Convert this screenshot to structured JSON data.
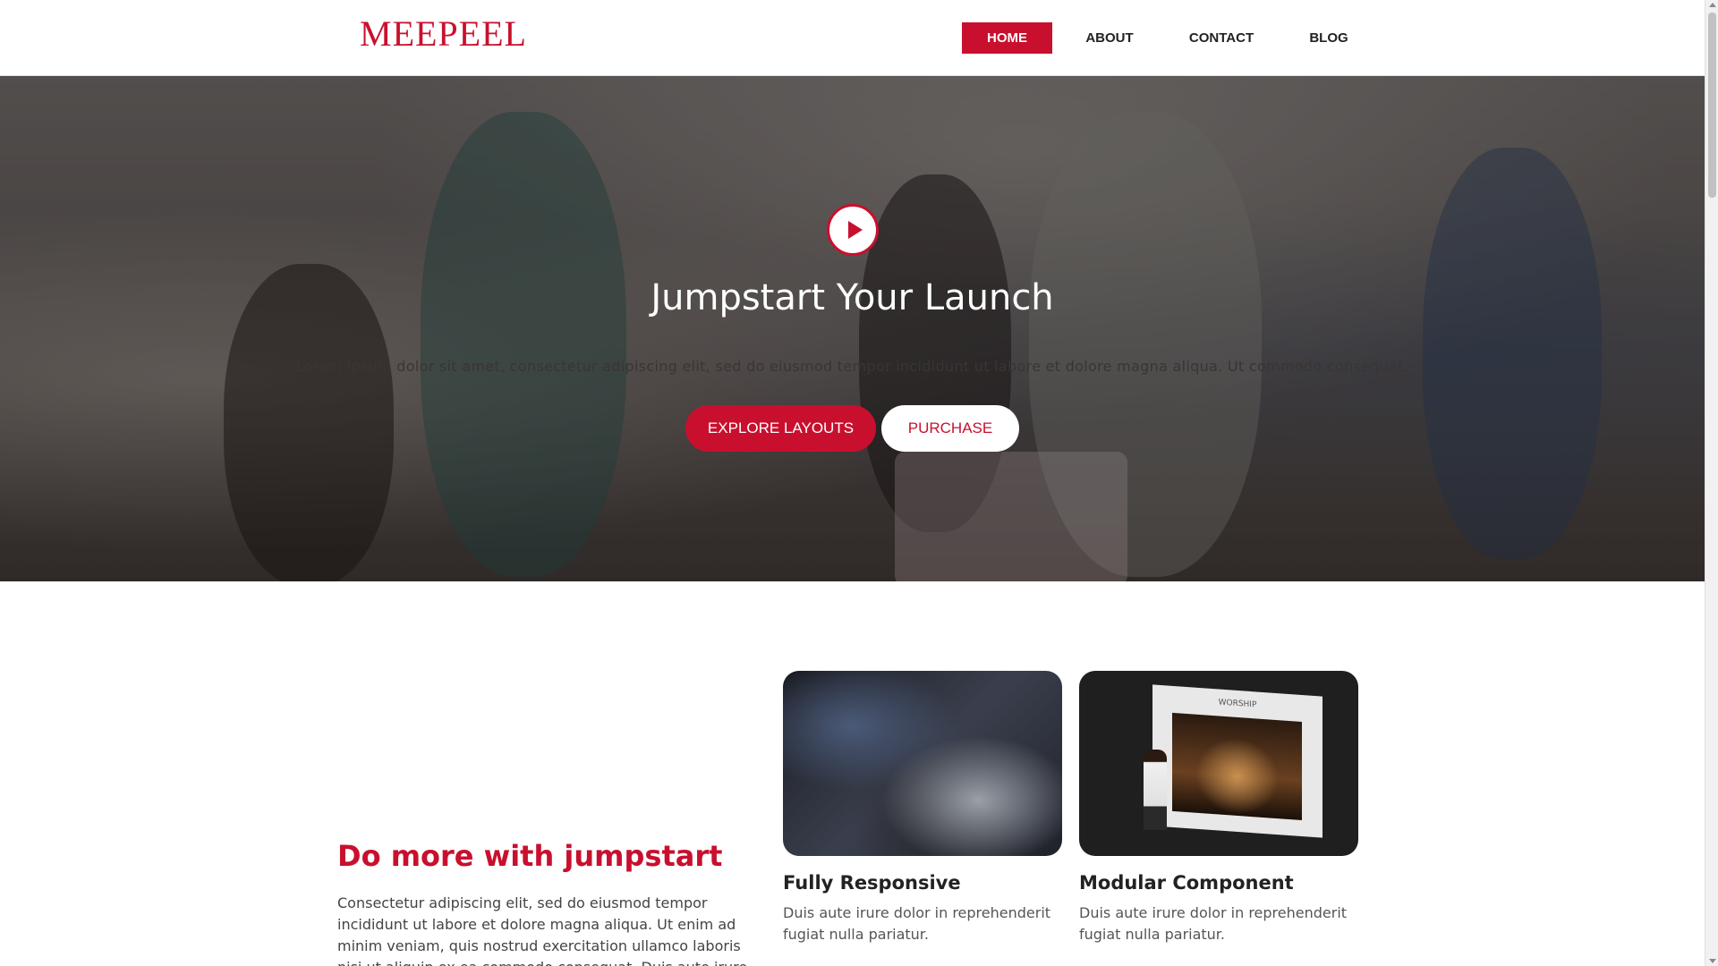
{
  "brand": {
    "logo": "MEEPEEL",
    "accent_color": "#c8102e"
  },
  "nav": {
    "items": [
      {
        "label": "HOME",
        "active": true
      },
      {
        "label": "ABOUT",
        "active": false
      },
      {
        "label": "CONTACT",
        "active": false
      },
      {
        "label": "BLOG",
        "active": false
      }
    ]
  },
  "hero": {
    "play_icon": "play-icon",
    "title": "Jumpstart Your Launch",
    "text": "Lorem ipsum dolor sit amet, consectetur adipiscing elit, sed do eiusmod tempor incididunt ut labore et dolore magna aliqua. Ut commodo consequat.",
    "primary_button": "EXPLORE LAYOUTS",
    "secondary_button": "PURCHASE"
  },
  "features": {
    "title": "Do more with jumpstart",
    "text": "Consectetur adipiscing elit, sed do eiusmod tempor incididunt ut labore et dolore magna aliqua. Ut enim ad minim veniam, quis nostrud exercitation ullamco laboris nisi ut aliquip ex ea commodo consequat. Duis aute irure",
    "cards": [
      {
        "title": "Fully Responsive",
        "text": "Duis aute irure dolor in reprehenderit fugiat nulla pariatur."
      },
      {
        "title": "Modular Component",
        "text": "Duis aute irure dolor in reprehenderit fugiat nulla pariatur.",
        "screen_label": "WORSHIP"
      }
    ]
  }
}
